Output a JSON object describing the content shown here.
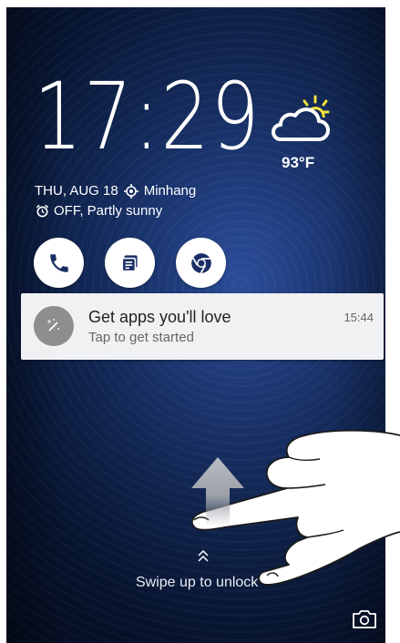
{
  "lockscreen": {
    "time": "17:29",
    "weather": {
      "icon": "partly-sunny-icon",
      "temperature": "93°F"
    },
    "date": "THU, AUG 18",
    "location": "Minhang",
    "alarm_status": "OFF, Partly sunny"
  },
  "shortcuts": [
    {
      "name": "phone-icon"
    },
    {
      "name": "messages-icon"
    },
    {
      "name": "chrome-icon"
    }
  ],
  "notification": {
    "title": "Get apps you'll love",
    "subtitle": "Tap to get started",
    "time": "15:44",
    "icon": "magic-wand-icon"
  },
  "unlock": {
    "hint": "Swipe up to unlock",
    "camera": "camera-icon"
  },
  "colors": {
    "wallpaper_center": "#2d4f9d",
    "wallpaper_edge": "#050d21",
    "notification_bg": "#f0f1f2",
    "sun_accent": "#f4e23a"
  }
}
